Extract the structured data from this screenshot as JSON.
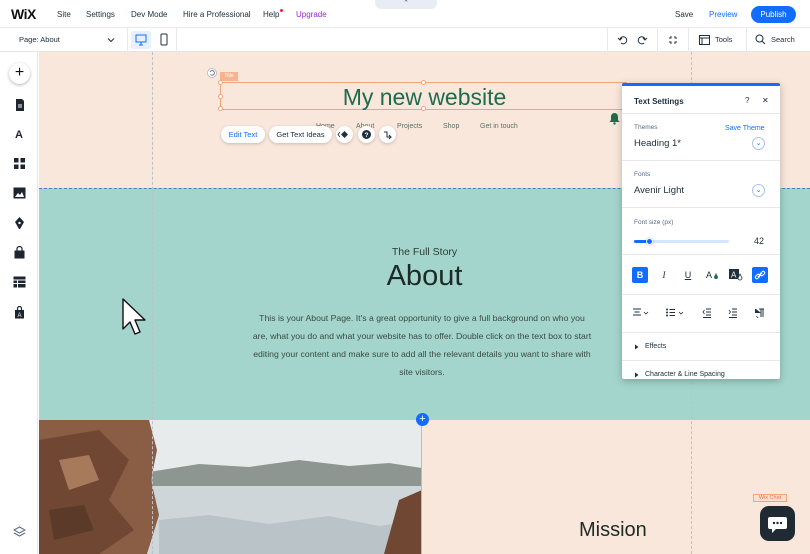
{
  "topbar": {
    "logo": "WiX",
    "menu": [
      "Site",
      "Settings",
      "Dev Mode",
      "Hire a Professional",
      "Help",
      "Upgrade"
    ],
    "collapse_glyph": "⌃",
    "save": "Save",
    "preview": "Preview",
    "publish": "Publish"
  },
  "toolbar": {
    "page_selector": "Page: About",
    "tools": "Tools",
    "search": "Search"
  },
  "rail": {
    "add_glyph": "+"
  },
  "canvas": {
    "title_tag": "Title",
    "site_title": "My new website",
    "nav_links": [
      "Home",
      "About",
      "Projects",
      "Shop",
      "Get in touch"
    ],
    "edit_text_button": "Edit Text",
    "get_text_ideas_button": "Get Text Ideas",
    "story_subtitle": "The Full Story",
    "about_title": "About",
    "about_body": "This is your About Page. It's a great opportunity to give a full background on who you are, what you do and what your website has to offer. Double click on the text box to start editing your content and make sure to add all the relevant details you want to share with site visitors.",
    "mission_title": "Mission",
    "wix_chat_tag": "Wix Chat"
  },
  "text_settings": {
    "title": "Text Settings",
    "help": "?",
    "close": "✕",
    "themes_label": "Themes",
    "save_theme": "Save Theme",
    "theme_value": "Heading 1*",
    "fonts_label": "Fonts",
    "font_value": "Avenir Light",
    "font_size_label": "Font size (px)",
    "font_size_value": "42",
    "font_size_fraction": 0.16,
    "effects_label": "Effects",
    "spacing_label": "Character & Line Spacing"
  },
  "colors": {
    "accent": "#116dff",
    "header_bg": "#f9e7dc",
    "about_bg": "#a3d5cc",
    "title_green": "#1e6b4e"
  }
}
